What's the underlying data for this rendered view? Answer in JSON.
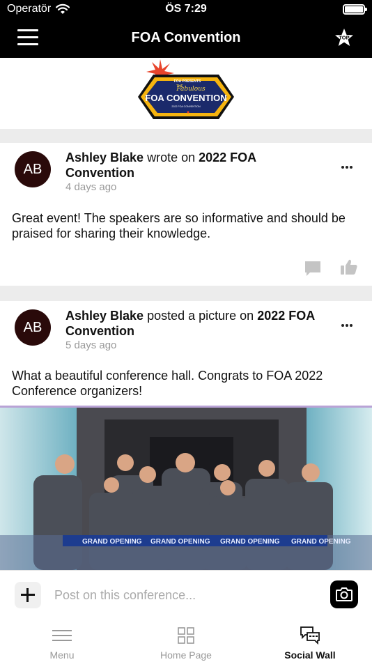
{
  "status_bar": {
    "carrier": "Operatör",
    "time": "ÖS 7:29"
  },
  "header": {
    "title": "FOA Convention",
    "top_badge": "TOP"
  },
  "logo": {
    "top_text": "FOA PRESENTS",
    "the": "THE",
    "fabulous": "Fabulous",
    "main": "FOA CONVENTION",
    "sub": "2022 FOA CONVENTION"
  },
  "posts": [
    {
      "avatar_initials": "AB",
      "author": "Ashley Blake",
      "action": "wrote on",
      "target_line1": "2022 FOA",
      "target_line2": "Convention",
      "time": "4 days ago",
      "text": "Great event!  The speakers are so informative and should be praised for sharing their knowledge."
    },
    {
      "avatar_initials": "AB",
      "author": "Ashley Blake",
      "action": "posted a picture on",
      "target_line1": "2022 FOA",
      "target_line2": "Convention",
      "time": "5 days ago",
      "text": "What a beautiful conference hall. Congrats to FOA 2022 Conference organizers!",
      "banner_text": "GRAND OPENING"
    }
  ],
  "composer": {
    "placeholder": "Post on this conference..."
  },
  "tabs": [
    {
      "label": "Menu",
      "icon": "menu-lines-icon"
    },
    {
      "label": "Home Page",
      "icon": "grid-icon"
    },
    {
      "label": "Social Wall",
      "icon": "chat-bubbles-icon",
      "active": true
    }
  ],
  "colors": {
    "header_bg": "#000000",
    "separator": "#ececec",
    "avatar_bg": "#2a0a0a",
    "muted": "#999999"
  }
}
